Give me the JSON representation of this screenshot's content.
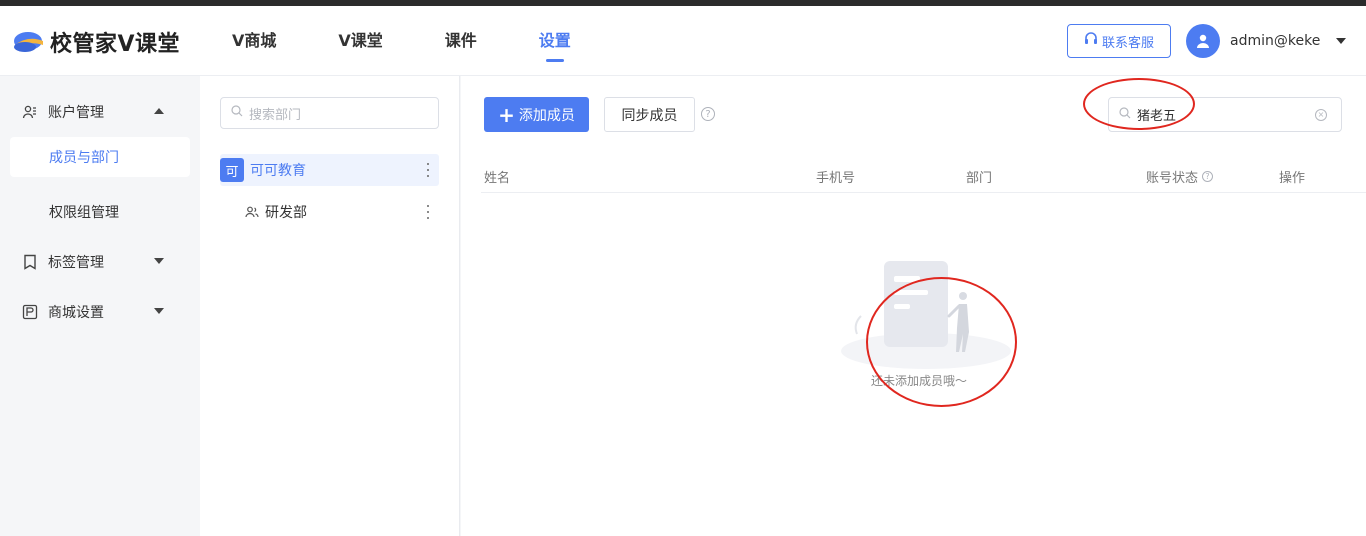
{
  "header": {
    "logo_text": "校管家V课堂",
    "nav": [
      {
        "label": "V商城"
      },
      {
        "label": "V课堂"
      },
      {
        "label": "课件"
      },
      {
        "label": "设置"
      }
    ],
    "support_label": "联系客服",
    "username": "admin@keke"
  },
  "sidebar": {
    "items": [
      {
        "label": "账户管理"
      },
      {
        "label": "成员与部门"
      },
      {
        "label": "权限组管理"
      },
      {
        "label": "标签管理"
      },
      {
        "label": "商城设置"
      }
    ]
  },
  "departments": {
    "search_placeholder": "搜索部门",
    "org": {
      "badge": "可",
      "name": "可可教育"
    },
    "children": [
      {
        "name": "研发部"
      }
    ]
  },
  "main": {
    "add_label": "添加成员",
    "sync_label": "同步成员",
    "help_glyph": "?",
    "search_value": "猪老五",
    "columns": [
      "姓名",
      "手机号",
      "部门",
      "账号状态",
      "操作"
    ],
    "empty_text": "还未添加成员哦～"
  },
  "colors": {
    "accent": "#4d7cf1",
    "annotation": "#e0271f"
  }
}
